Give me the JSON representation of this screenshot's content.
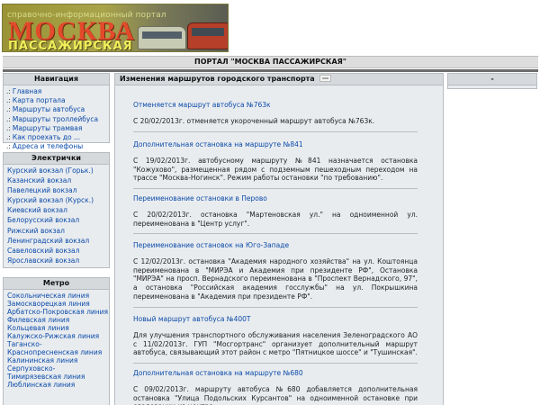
{
  "logo": {
    "tagline": "справочно-информационный портал",
    "title_main": "МОСКВА",
    "title_sub": "ПАССАЖИРСКАЯ"
  },
  "portal_title": "ПОРТАЛ \"МОСКВА ПАССАЖИРСКАЯ\"",
  "nav": {
    "title": "Навигация",
    "bullet": ".:",
    "items": [
      "Главная",
      "Карта портала",
      "Маршруты автобуса",
      "Маршруты троллейбуса",
      "Маршруты трамвая",
      "Как проехать до ...",
      "Адреса и телефоны"
    ]
  },
  "elektrichki": {
    "title": "Электрички",
    "items": [
      "Курский вокзал (Горьк.)",
      "Казанский вокзал",
      "Павелецкий вокзал",
      "Курский вокзал (Курск.)",
      "Киевский вокзал",
      "Белорусский вокзал",
      "Рижский вокзал",
      "Ленинградский вокзал",
      "Савеловский вокзал",
      "Ярославский вокзал"
    ]
  },
  "metro": {
    "title": "Метро",
    "items": [
      "Сокольническая линия",
      "Замоскворецкая линия",
      "Арбатско-Покровская линия",
      "Филевская линия",
      "Кольцевая линия",
      "Калужско-Рижская линия",
      "Таганско-Краснопресненская линия",
      "Калининская линия",
      "Серпуховско-Тимирязевская линия",
      "Люблинская линия"
    ]
  },
  "main": {
    "title": "Изменения маршрутов городского транспорта",
    "rss_icon": "rss-icon",
    "news": [
      {
        "title": "Отменяется маршрут автобуса №763к",
        "body": "С 20/02/2013г. отменяется укороченный маршрут автобуса №763к."
      },
      {
        "title": "Дополнительная остановка на маршруте №841",
        "body": "С 19/02/2013г. автобусному маршруту №841 назначается остановка \"Кожухово\", размещенная рядом с подземным пешеходным переходом на трассе \"Москва-Ногинск\". Режим работы остановки \"по требованию\"."
      },
      {
        "title": "Переименование остановки в Перово",
        "body": "С 20/02/2013г. остановка \"Мартеновская ул.\" на одноименной ул. переименована в \"Центр услуг\"."
      },
      {
        "title": "Переименование остановок на Юго-Западе",
        "body": "С 12/02/2013г. остановка \"Академия народного хозяйства\" на ул. Коштоянца переименована в \"МИРЭА и Академия при президенте РФ\", Остановка \"МИРЭА\" на просп. Вернадского переименована в \"Проспект Вернадского, 97\", а остановка \"Российская академия госслужбы\" на ул. Покрышкина переименована в \"Академия при президенте РФ\"."
      },
      {
        "title": "Новый маршрут автобуса №400Т",
        "body": "Для улучшения транспортного обслуживания населения Зеленоградского АО с 11/02/2013г. ГУП \"Мосгортранс\" организует дополнительный маршрут автобуса, связывающий этот район с метро \"Пятницкое шоссе\" и \"Тушинская\"."
      },
      {
        "title": "Дополнительная остановка на маршруте №680",
        "body": "С 09/02/2013г. маршруту автобуса №680 добавляется дополнительная остановка \"Улица Подольских Курсантов\" на одноименной остановке при следовании из центра."
      }
    ]
  },
  "right": {
    "title": "-"
  }
}
